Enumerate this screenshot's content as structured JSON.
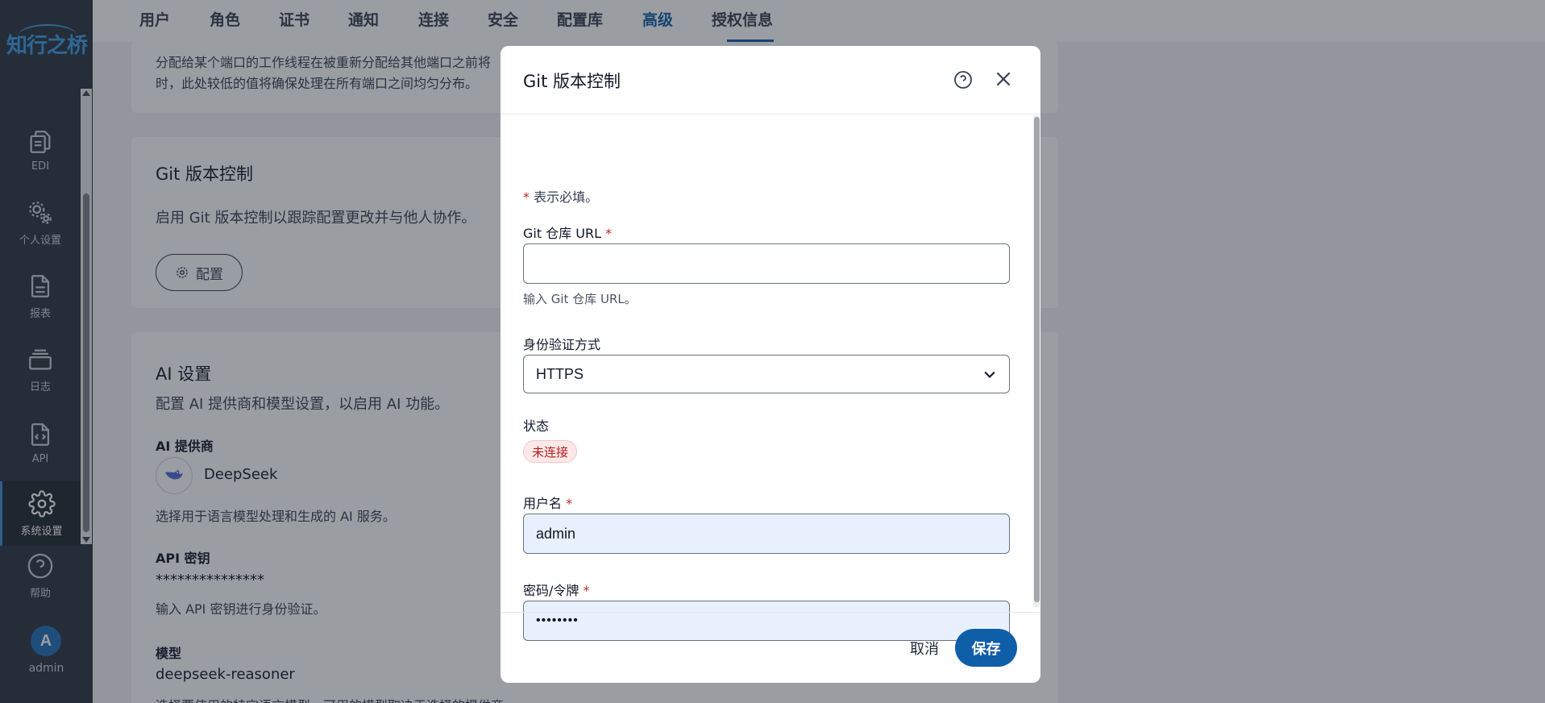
{
  "app": {
    "logo_text": "知行之桥"
  },
  "sidebar": {
    "items": [
      {
        "label": "EDI",
        "icon": "document-copy-icon"
      },
      {
        "label": "个人设置",
        "icon": "gears-icon"
      },
      {
        "label": "报表",
        "icon": "report-icon"
      },
      {
        "label": "日志",
        "icon": "log-stack-icon"
      },
      {
        "label": "API",
        "icon": "api-file-icon"
      },
      {
        "label": "系统设置",
        "icon": "gear-icon",
        "active": true
      },
      {
        "label": "帮助",
        "icon": "help-circle-icon"
      }
    ],
    "user": {
      "initial": "A",
      "name": "admin"
    }
  },
  "tabs": [
    {
      "label": "用户"
    },
    {
      "label": "角色"
    },
    {
      "label": "证书"
    },
    {
      "label": "通知"
    },
    {
      "label": "连接"
    },
    {
      "label": "安全"
    },
    {
      "label": "配置库"
    },
    {
      "label": "高级",
      "active": true
    },
    {
      "label": "授权信息"
    }
  ],
  "background": {
    "thread_note_line1": "分配给某个端口的工作线程在被重新分配给其他端口之前将",
    "thread_note_line2": "时，此处较低的值将确保处理在所有端口之间均匀分布。",
    "git_card": {
      "title": "Git 版本控制",
      "description": "启用 Git 版本控制以跟踪配置更改并与他人协作。",
      "config_button": "配置"
    },
    "ai_card": {
      "title": "AI 设置",
      "description": "配置 AI 提供商和模型设置，以启用 AI 功能。",
      "provider_label": "AI 提供商",
      "provider_value": "DeepSeek",
      "provider_hint": "选择用于语言模型处理和生成的 AI 服务。",
      "api_key_label": "API 密钥",
      "api_key_value": "***************",
      "api_key_hint": "输入 API 密钥进行身份验证。",
      "model_label": "模型",
      "model_value": "deepseek-reasoner",
      "model_hint": "选择要使用的特定语言模型。可用的模型取决于选择的提供商。"
    }
  },
  "modal": {
    "title": "Git 版本控制",
    "required_note": "表示必填。",
    "repo_url": {
      "label": "Git 仓库 URL",
      "value": "",
      "hint": "输入 Git 仓库 URL。"
    },
    "auth_method": {
      "label": "身份验证方式",
      "value": "HTTPS"
    },
    "status": {
      "label": "状态",
      "value": "未连接"
    },
    "username": {
      "label": "用户名",
      "value": "admin"
    },
    "password": {
      "label": "密码/令牌",
      "value": "••••••••"
    },
    "cancel_label": "取消",
    "save_label": "保存"
  },
  "colors": {
    "accent": "#0f5ea8",
    "sidebar_bg": "#2a3340",
    "status_error": "#b91c1c"
  }
}
